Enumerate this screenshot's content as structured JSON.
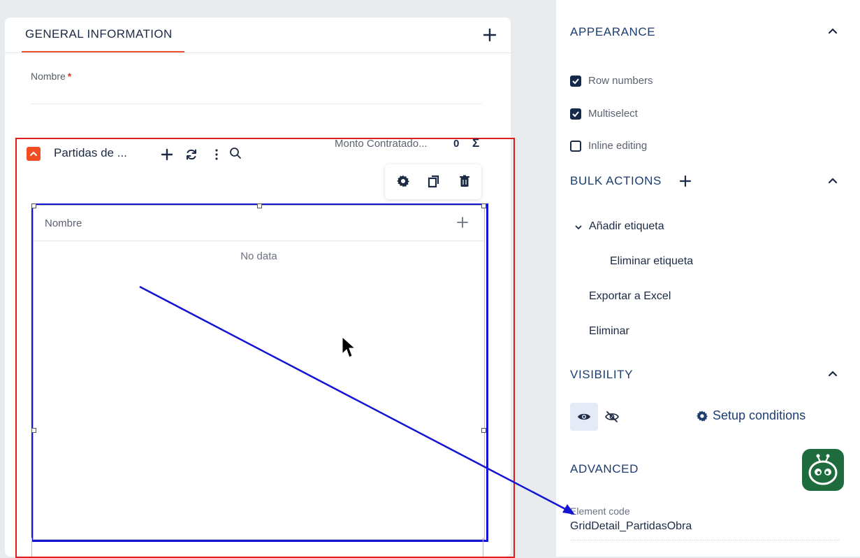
{
  "form": {
    "tab_general": "GENERAL INFORMATION",
    "field_label": "Nombre",
    "required_mark": "*"
  },
  "grid": {
    "title": "Partidas de ...",
    "monto_label": "Monto Contratado...",
    "monto_value": "0",
    "sigma": "Σ",
    "column_header": "Nombre",
    "empty_text": "No data"
  },
  "panel": {
    "appearance_title": "APPEARANCE",
    "row_numbers": "Row numbers",
    "multiselect": "Multiselect",
    "inline_editing": "Inline editing",
    "bulk_title": "BULK ACTIONS",
    "bulk_items": [
      "Añadir etiqueta",
      "Eliminar etiqueta",
      "Exportar a Excel",
      "Eliminar"
    ],
    "visibility_title": "VISIBILITY",
    "setup_conditions": "Setup conditions",
    "advanced_title": "ADVANCED",
    "element_code_label": "Element code",
    "element_code_value": "GridDetail_PartidasObra"
  },
  "checkbox_states": {
    "row_numbers": true,
    "multiselect": true,
    "inline_editing": false
  },
  "colors": {
    "accent_orange": "#f04d22",
    "highlight_red": "#e21b1b",
    "selection_blue": "#1414d4",
    "navy": "#152a4a",
    "robot_green": "#1e6b3e"
  }
}
